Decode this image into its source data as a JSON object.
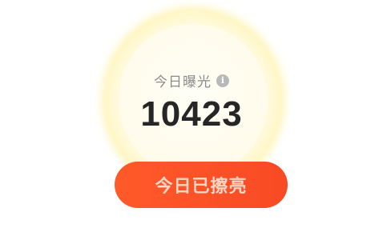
{
  "exposure": {
    "title": "今日曝光",
    "info_icon": "info-icon",
    "count": "10423"
  },
  "action": {
    "button_label": "今日已擦亮"
  },
  "colors": {
    "accent": "#f84a24",
    "glow": "#fde98a",
    "count_text": "#262626"
  }
}
